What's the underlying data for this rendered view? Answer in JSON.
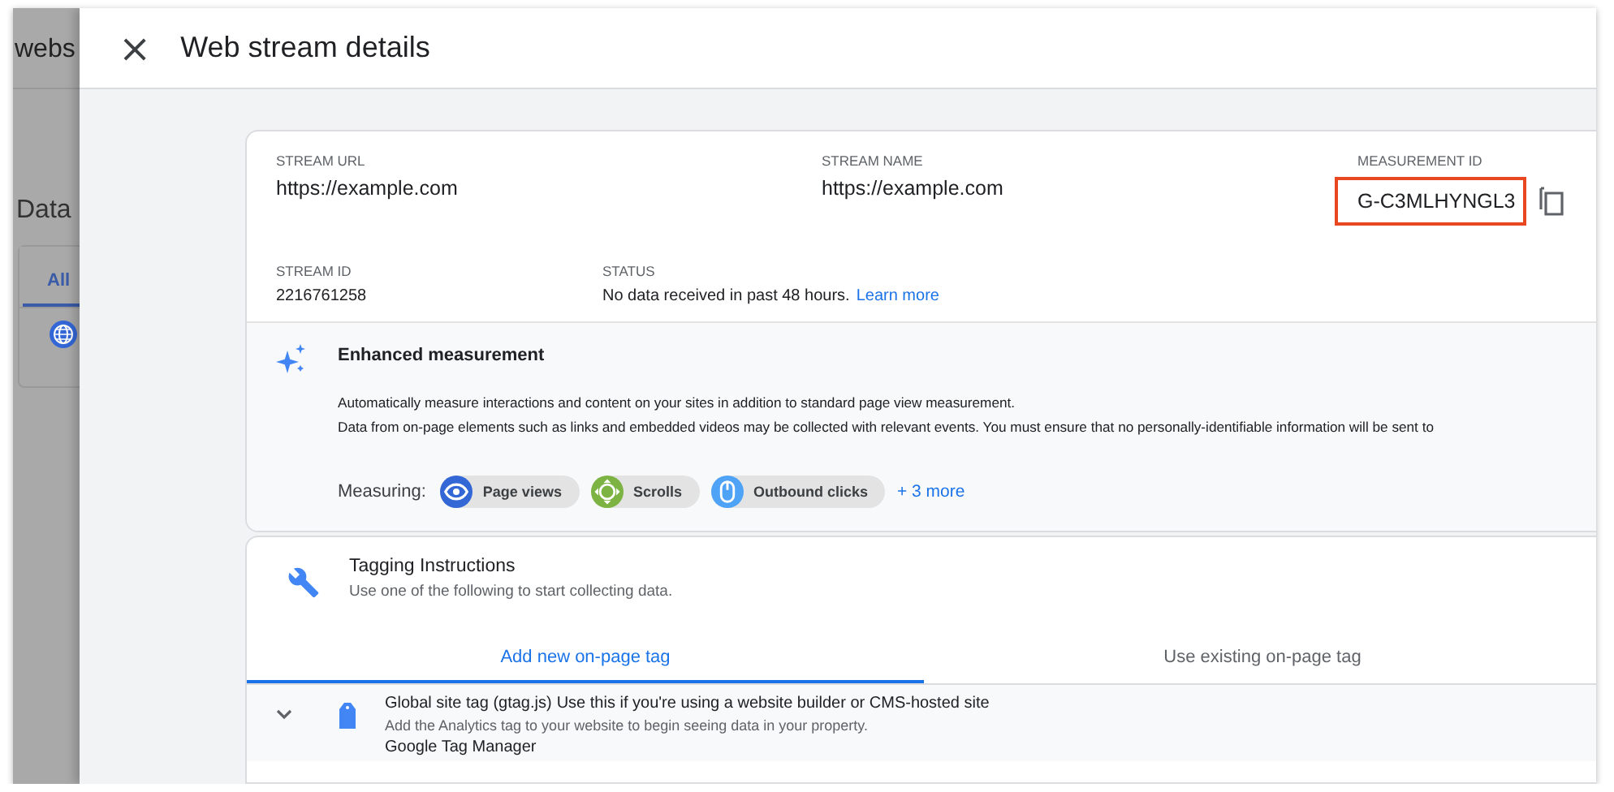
{
  "background_page": {
    "title": "webs",
    "section": "Data",
    "tabs": [
      {
        "label": "All",
        "selected": true
      }
    ]
  },
  "panel": {
    "title": "Web stream details",
    "close": "×"
  },
  "stream": {
    "fields": [
      {
        "label": "STREAM URL",
        "value": "https://example.com"
      },
      {
        "label": "STREAM NAME",
        "value": "https://example.com"
      },
      {
        "label": "MEASUREMENT ID",
        "value": "G-C3MLHYNGL3",
        "highlighted": true
      }
    ],
    "details": [
      {
        "label": "STREAM ID",
        "value": "2216761258"
      },
      {
        "label": "STATUS",
        "value": "No data received in past 48 hours.",
        "link": "Learn more"
      }
    ]
  },
  "enhanced_measurement": {
    "title": "Enhanced measurement",
    "description": [
      "Automatically measure interactions and content on your sites in addition to standard page view measurement.",
      "Data from on-page elements such as links and embedded videos may be collected with relevant events. You must ensure that no personally-identifiable information will be sent to"
    ],
    "measuring_label": "Measuring:",
    "chips": [
      {
        "label": "Page views",
        "kind": "eye",
        "color": "#3367d6"
      },
      {
        "label": "Scrolls",
        "kind": "scroll",
        "color": "#7cb342"
      },
      {
        "label": "Outbound clicks",
        "kind": "mouse",
        "color": "#4fa3f7"
      }
    ],
    "more": "+ 3 more"
  },
  "tagging": {
    "title": "Tagging Instructions",
    "subtitle": "Use one of the following to start collecting data.",
    "tabs": [
      {
        "label": "Add new on-page tag",
        "selected": true
      },
      {
        "label": "Use existing on-page tag",
        "selected": false
      }
    ],
    "options": [
      {
        "title": "Global site tag (gtag.js)",
        "note": "Use this if you're using a website builder or CMS-hosted site",
        "description": "Add the Analytics tag to your website to begin seeing data in your property.",
        "expanded": false
      },
      {
        "title": "Google Tag Manager"
      }
    ]
  }
}
